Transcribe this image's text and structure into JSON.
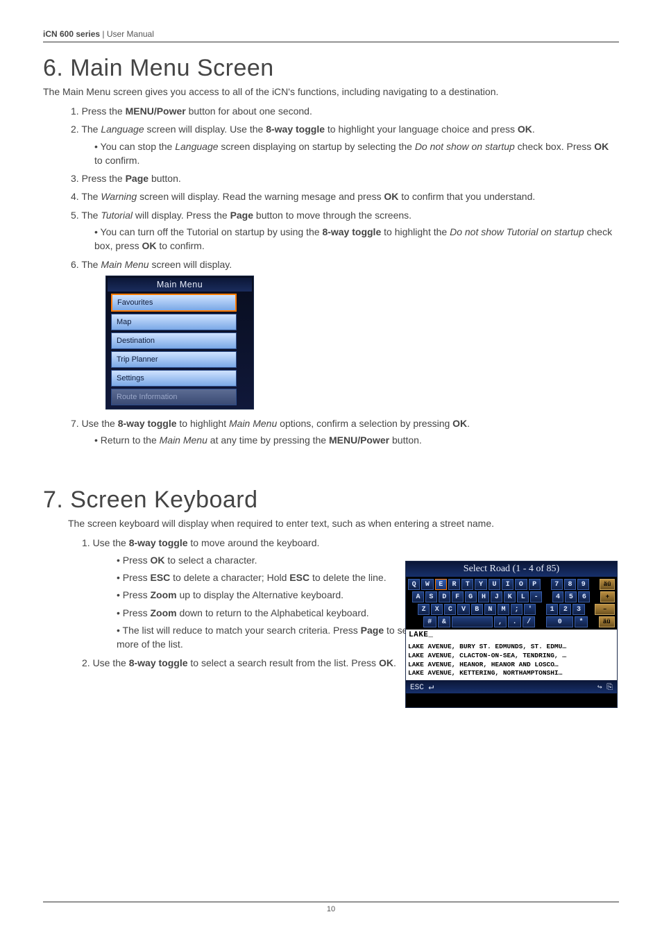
{
  "header": {
    "series": "iCN 600 series",
    "divider": " | ",
    "doc": "User Manual"
  },
  "section6": {
    "title": "6. Main Menu Screen",
    "intro": "The Main Menu screen gives you access to all of the iCN's functions, including navigating to a destination.",
    "steps": {
      "s1_pre": "1. Press the ",
      "s1_b": "MENU/Power",
      "s1_post": " button for about one second.",
      "s2_pre": "2. The ",
      "s2_i1": "Language",
      "s2_mid": " screen will display. Use the ",
      "s2_b1": "8-way toggle",
      "s2_mid2": " to highlight your language choice and press ",
      "s2_b2": "OK",
      "s2_post": ".",
      "s2a_pre": "You can stop the ",
      "s2a_i": "Language",
      "s2a_mid": " screen displaying on startup by selecting the ",
      "s2a_i2": "Do not show on startup",
      "s2a_mid2": " check box. Press ",
      "s2a_b": "OK",
      "s2a_post": " to confirm.",
      "s3_pre": "3. Press the ",
      "s3_b": "Page",
      "s3_post": " button.",
      "s4_pre": "4. The ",
      "s4_i": "Warning",
      "s4_mid": " screen will display. Read the warning mesage and press ",
      "s4_b": "OK",
      "s4_post": " to confirm that you understand.",
      "s5_pre": "5. The ",
      "s5_i": "Tutorial",
      "s5_mid": " will display. Press the ",
      "s5_b": "Page",
      "s5_post": " button to move through the screens.",
      "s5a_pre": "You can turn off the Tutorial on startup by using the ",
      "s5a_b1": "8-way toggle",
      "s5a_mid": " to highlight the ",
      "s5a_i": "Do not show Tutorial on startup",
      "s5a_mid2": " check box, press ",
      "s5a_b2": "OK",
      "s5a_post": " to confirm.",
      "s6_pre": "6. The ",
      "s6_i": "Main Menu",
      "s6_post": " screen will display.",
      "s7_pre": "7. Use the ",
      "s7_b1": "8-way toggle",
      "s7_mid": " to highlight ",
      "s7_i": "Main Menu",
      "s7_mid2": " options, confirm a selection by pressing ",
      "s7_b2": "OK",
      "s7_post": ".",
      "s7a_pre": "Return to the ",
      "s7a_i": "Main Menu",
      "s7a_mid": " at any time by pressing the ",
      "s7a_b": "MENU/Power",
      "s7a_post": " button."
    },
    "mm": {
      "title": "Main Menu",
      "i1": "Favourites",
      "i2": "Map",
      "i3": "Destination",
      "i4": "Trip Planner",
      "i5": "Settings",
      "i6": "Route Information"
    }
  },
  "section7": {
    "title": "7. Screen Keyboard",
    "intro": "The screen keyboard will display when required to enter text, such as when entering a street name.",
    "steps": {
      "s1_pre": "1. Use the ",
      "s1_b": "8-way toggle",
      "s1_post": " to move around the keyboard.",
      "s1a_pre": "Press ",
      "s1a_b": "OK",
      "s1a_post": " to select a character.",
      "s1b_pre": "Press ",
      "s1b_b1": "ESC",
      "s1b_mid": " to delete a character; Hold ",
      "s1b_b2": "ESC",
      "s1b_post": " to delete the line.",
      "s1c_pre": "Press ",
      "s1c_b": "Zoom",
      "s1c_post": " up to display the Alternative keyboard.",
      "s1d_pre": "Press ",
      "s1d_b": "Zoom",
      "s1d_post": " down to return to the Alphabetical keyboard.",
      "s1e_pre": "The list will reduce to match your search criteria. Press ",
      "s1e_b": "Page",
      "s1e_post": " to see more of the list.",
      "s2_pre": "2. Use the ",
      "s2_b1": "8-way toggle",
      "s2_mid": " to select a search result from the list. Press ",
      "s2_b2": "OK",
      "s2_post": "."
    },
    "kb": {
      "title": "Select Road (1 - 4 of 85)",
      "field": "LAKE_",
      "r1": "LAKE AVENUE, BURY ST. EDMUNDS, ST. EDMU…",
      "r2": "LAKE AVENUE, CLACTON-ON-SEA, TENDRING, …",
      "r3": "LAKE AVENUE, HEANOR, HEANOR AND LOSCO…",
      "r4": "LAKE AVENUE, KETTERING, NORTHAMPTONSHI…",
      "esc": "ESC",
      "alt1": "äü",
      "alt2": "äü",
      "plus": "+",
      "dash": "–",
      "keys": {
        "row1": [
          "Q",
          "W",
          "E",
          "R",
          "T",
          "Y",
          "U",
          "I",
          "O",
          "P",
          "7",
          "8",
          "9"
        ],
        "row2": [
          "A",
          "S",
          "D",
          "F",
          "G",
          "H",
          "J",
          "K",
          "L",
          "-",
          "4",
          "5",
          "6"
        ],
        "row3": [
          "Z",
          "X",
          "C",
          "V",
          "B",
          "N",
          "M",
          ";",
          "'",
          "1",
          "2",
          "3"
        ],
        "row4": [
          "#",
          "&",
          "",
          ",",
          ".",
          "/",
          "0",
          "*"
        ]
      }
    }
  },
  "footer": {
    "page": "10"
  }
}
